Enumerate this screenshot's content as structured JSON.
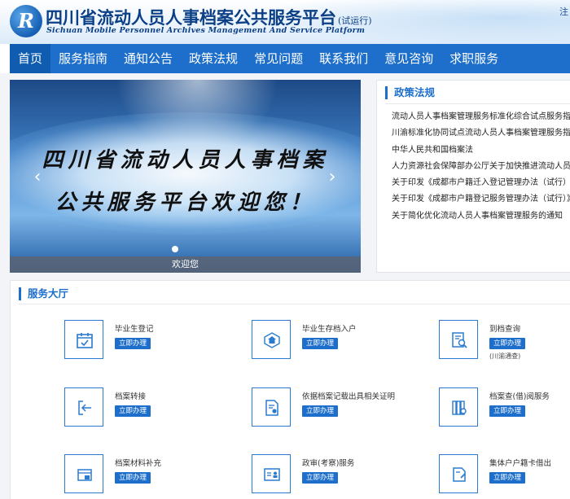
{
  "header": {
    "logo_letter": "R",
    "title": "四川省流动人员人事档案公共服务平台",
    "title_note": "(试运行)",
    "subtitle": "Sichuan Mobile Personnel Archives Management And Service Platform",
    "top_link": "注"
  },
  "nav": {
    "items": [
      "首页",
      "服务指南",
      "通知公告",
      "政策法规",
      "常见问题",
      "联系我们",
      "意见咨询",
      "求职服务"
    ],
    "active_index": 0
  },
  "banner": {
    "line1": "四川省流动人员人事档案",
    "line2": "公共服务平台欢迎您！",
    "caption": "欢迎您",
    "prev_glyph": "‹",
    "next_glyph": "›"
  },
  "policy": {
    "title": "政策法规",
    "items": [
      "流动人员人事档案管理服务标准化综合试点服务指南",
      "川渝标准化协同试点流动人员人事档案管理服务指南",
      "中华人民共和国档案法",
      "人力资源社会保障部办公厅关于加快推进流动人员人",
      "关于印发《成都市户籍迁入登记管理办法（试行）实",
      "关于印发《成都市户籍登记服务管理办法（试行）》",
      "关于简化优化流动人员人事档案管理服务的通知"
    ]
  },
  "services": {
    "title": "服务大厅",
    "button_label": "立即办理",
    "items": [
      {
        "name": "毕业生登记",
        "icon": "calendar-check-icon",
        "note": ""
      },
      {
        "name": "毕业生存档入户",
        "icon": "home-badge-icon",
        "note": ""
      },
      {
        "name": "到档查询",
        "icon": "document-search-icon",
        "note": "(川渝通查)"
      },
      {
        "name": "档案转接",
        "icon": "transfer-icon",
        "note": ""
      },
      {
        "name": "依据档案记载出具相关证明",
        "icon": "certificate-icon",
        "note": ""
      },
      {
        "name": "档案查(借)阅服务",
        "icon": "folders-icon",
        "note": ""
      },
      {
        "name": "档案材料补充",
        "icon": "material-add-icon",
        "note": ""
      },
      {
        "name": "政审(考察)服务",
        "icon": "id-card-icon",
        "note": ""
      },
      {
        "name": "集体户户籍卡借出",
        "icon": "card-lend-icon",
        "note": ""
      }
    ]
  },
  "colors": {
    "primary": "#1d6fcb",
    "nav_active": "#0f5cb0",
    "title_blue": "#0b3f86"
  }
}
